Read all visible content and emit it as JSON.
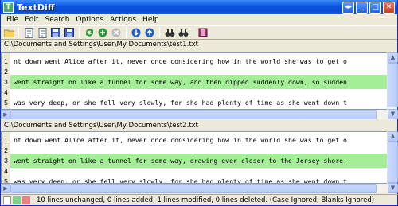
{
  "window": {
    "title": "TextDiff",
    "app_icon": "T"
  },
  "menu": [
    "File",
    "Edit",
    "Search",
    "Options",
    "Actions",
    "Help"
  ],
  "toolbar_icons": [
    "open-folder-icon",
    "open-file-icon",
    "open-file-2-icon",
    "save-icon",
    "save-2-icon",
    "refresh-icon",
    "add-icon",
    "remove-icon",
    "prev-diff-icon",
    "next-diff-icon",
    "find-icon",
    "find-next-icon",
    "help-book-icon"
  ],
  "pane1": {
    "path": "C:\\Documents and Settings\\User\\My Documents\\test1.txt",
    "lines": [
      {
        "num": "1",
        "text": "nt down went Alice after it, never once considering how in the world she was to get o",
        "mod": false
      },
      {
        "num": "2",
        "text": "",
        "mod": false
      },
      {
        "num": "3",
        "text": "went straight on like a tunnel for some way, and then dipped suddenly down, so sudden",
        "mod": true
      },
      {
        "num": "4",
        "text": "",
        "mod": false
      },
      {
        "num": "5",
        "text": "was very deep, or she fell very slowly, for she had plenty of time as she went down t",
        "mod": false
      }
    ]
  },
  "pane2": {
    "path": "C:\\Documents and Settings\\User\\My Documents\\test2.txt",
    "lines": [
      {
        "num": "1",
        "text": "nt down went Alice after it, never once considering how in the world she was to get o",
        "mod": false
      },
      {
        "num": "2",
        "text": "",
        "mod": false
      },
      {
        "num": "3",
        "text": "went straight on like a tunnel for some way, drawing ever closer to the Jersey shore,",
        "mod": true
      },
      {
        "num": "4",
        "text": "",
        "mod": false
      },
      {
        "num": "5",
        "text": "was very deep, or she fell very slowly, for she had plenty of time as she went down t",
        "mod": false
      }
    ]
  },
  "status": {
    "text": "10 lines unchanged,  0 lines added, 1 lines modified, 0 lines deleted.   (Case Ignored, Blanks Ignored)",
    "colors": {
      "unchanged": "#ffffff",
      "added": "#7ed37e",
      "deleted": "#f08080",
      "modified": "#a4ee98"
    }
  }
}
